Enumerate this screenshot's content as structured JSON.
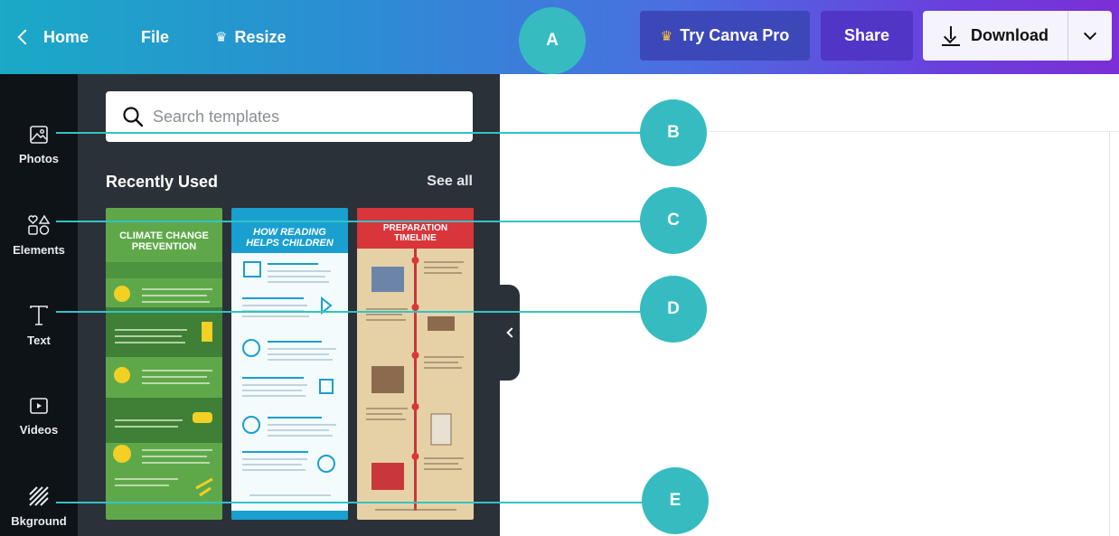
{
  "topbar": {
    "home_label": "Home",
    "file_label": "File",
    "resize_label": "Resize",
    "try_pro_label": "Try Canva Pro",
    "share_label": "Share",
    "download_label": "Download"
  },
  "rail": {
    "items": [
      {
        "label": "Photos",
        "icon": "photos-icon"
      },
      {
        "label": "Elements",
        "icon": "elements-icon"
      },
      {
        "label": "Text",
        "icon": "text-icon"
      },
      {
        "label": "Videos",
        "icon": "videos-icon"
      },
      {
        "label": "Bkground",
        "icon": "background-icon"
      }
    ]
  },
  "panel": {
    "search_placeholder": "Search templates",
    "recent_title": "Recently Used",
    "see_all": "See all",
    "templates": [
      {
        "title": "CLIMATE CHANGE PREVENTION",
        "color": "#5fa84a"
      },
      {
        "title": "HOW READING HELPS CHILDREN",
        "color": "#1a9fd1"
      },
      {
        "title": "PREPARATION TIMELINE",
        "color": "#e6d1a6"
      }
    ]
  },
  "annotations": [
    "A",
    "B",
    "C",
    "D",
    "E"
  ],
  "colors": {
    "accent": "#36bcc0",
    "topbar_start": "#1aa9c6",
    "topbar_end": "#7b2fd6",
    "panel_bg": "#2b3138",
    "rail_bg": "#0e1318"
  }
}
